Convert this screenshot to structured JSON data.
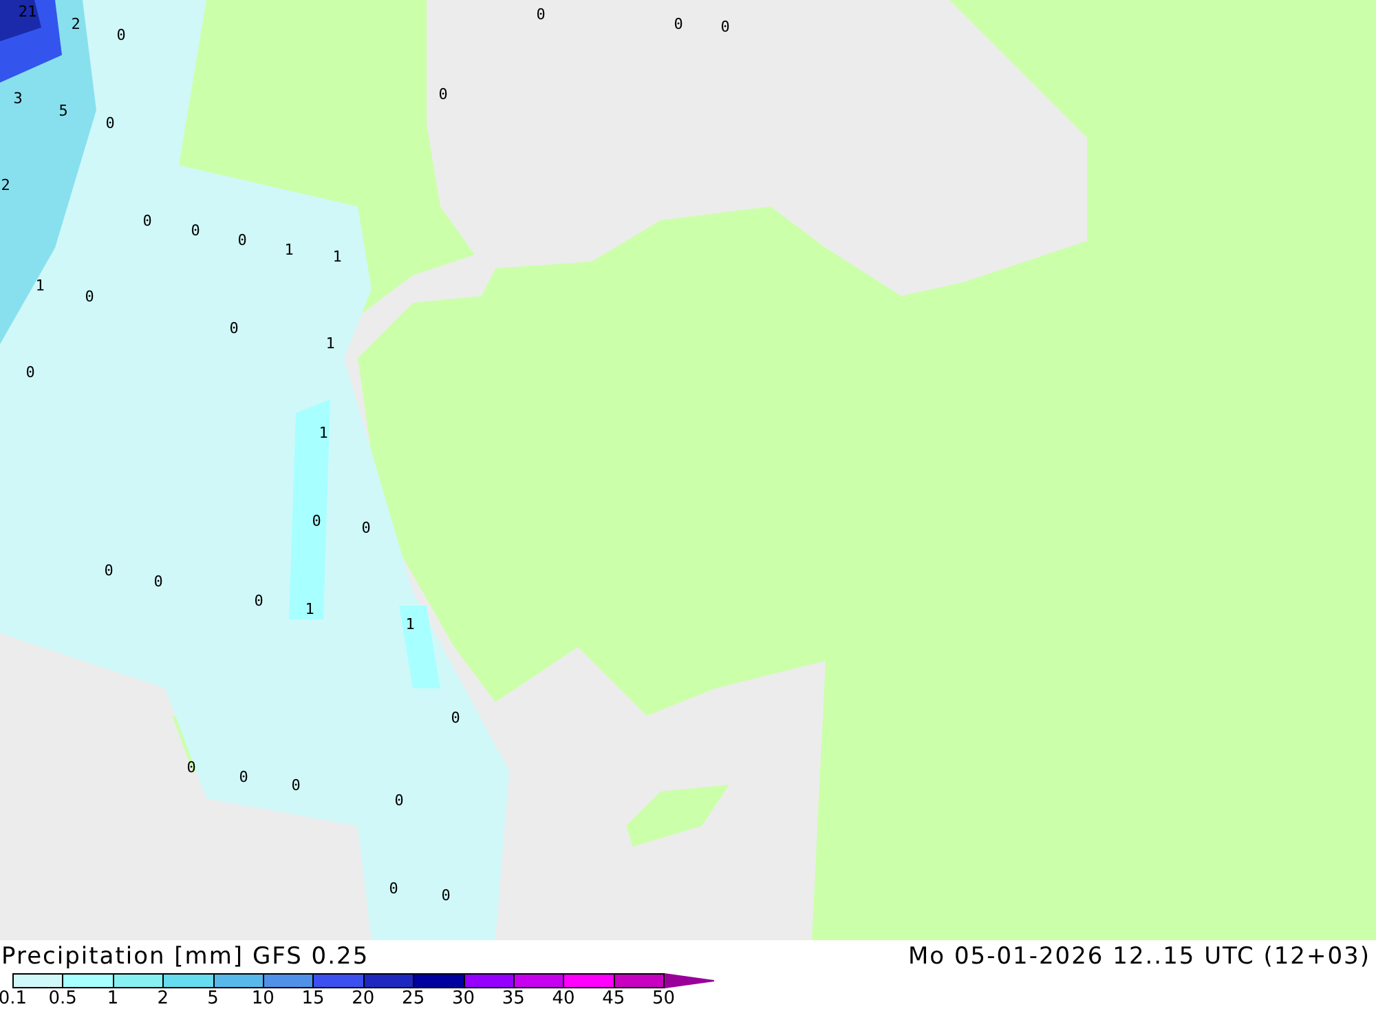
{
  "map": {
    "value_labels": [
      "21",
      "2",
      "0",
      "0",
      "0",
      "0",
      "0",
      "3",
      "5",
      "0",
      "2",
      "0",
      "0",
      "0",
      "1",
      "1",
      "1",
      "0",
      "0",
      "1",
      "0",
      "1",
      "0",
      "0",
      "0",
      "0",
      "0",
      "1",
      "1",
      "0",
      "0",
      "0",
      "0",
      "0",
      "0",
      "0"
    ]
  },
  "legend": {
    "title": "Precipitation [mm] GFS 0.25",
    "valid_time": "Mo 05-01-2026 12..15 UTC (12+03)",
    "bins": [
      {
        "color": "#d0f8f8"
      },
      {
        "color": "#a8ffff"
      },
      {
        "color": "#88f0f0"
      },
      {
        "color": "#66dcee"
      },
      {
        "color": "#58b8ea"
      },
      {
        "color": "#5090e8"
      },
      {
        "color": "#3c50f0"
      },
      {
        "color": "#1e28c0"
      },
      {
        "color": "#0000a0"
      },
      {
        "color": "#9600ff"
      },
      {
        "color": "#c800f0"
      },
      {
        "color": "#ff00ff"
      },
      {
        "color": "#c800c0"
      }
    ],
    "ticks": [
      "0.1",
      "0.5",
      "1",
      "2",
      "5",
      "10",
      "15",
      "20",
      "25",
      "30",
      "35",
      "40",
      "45",
      "50"
    ]
  }
}
